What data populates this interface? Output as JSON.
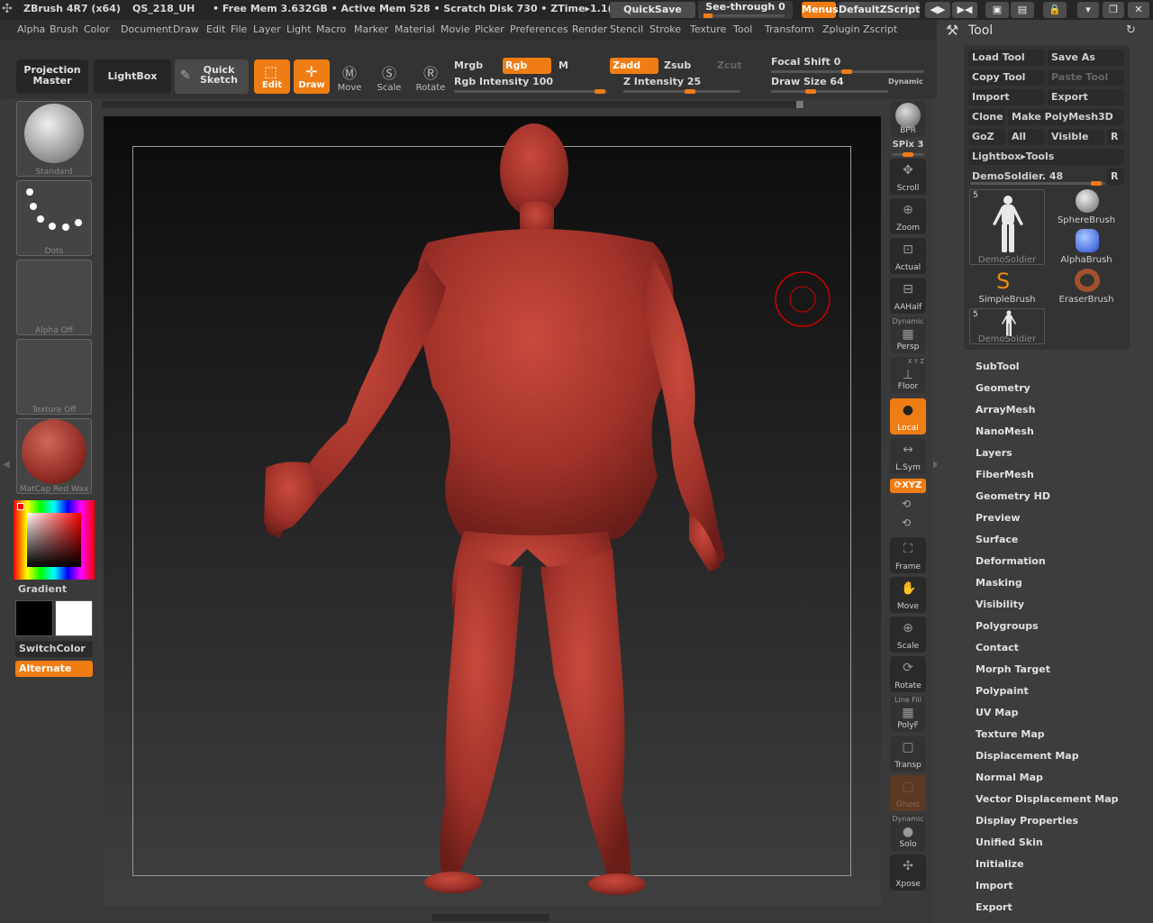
{
  "titlebar": {
    "app_title": "ZBrush 4R7 (x64)",
    "doc_name": "QS_218_UH",
    "free_mem": "• Free Mem 3.632GB • Active Mem 528 • Scratch Disk 730 • ZTime▸1.1(",
    "quicksave": "QuickSave",
    "see_through": "See-through 0",
    "menus": "Menus",
    "default_zscript": "DefaultZScript"
  },
  "menu": [
    "Alpha",
    "Brush",
    "Color",
    "Document",
    "Draw",
    "Edit",
    "File",
    "Layer",
    "Light",
    "Macro",
    "Marker",
    "Material",
    "Movie",
    "Picker",
    "Preferences",
    "Render",
    "Stencil",
    "Stroke",
    "Texture",
    "Tool",
    "Transform",
    "Zplugin",
    "Zscript"
  ],
  "toolbar": {
    "projection_master": "Projection\nMaster",
    "lightbox": "LightBox",
    "quick_sketch": "Quick\nSketch",
    "edit": "Edit",
    "draw": "Draw",
    "move": "Move",
    "scale": "Scale",
    "rotate": "Rotate",
    "mrgb": "Mrgb",
    "rgb": "Rgb",
    "m": "M",
    "zadd": "Zadd",
    "zsub": "Zsub",
    "zcut": "Zcut",
    "rgb_intensity": "Rgb Intensity 100",
    "z_intensity": "Z Intensity 25",
    "focal_shift": "Focal Shift 0",
    "draw_size": "Draw Size 64",
    "dynamic": "Dynamic"
  },
  "left": {
    "brush": "Standard",
    "stroke": "Dots",
    "alpha": "Alpha Off",
    "texture": "Texture Off",
    "material": "MatCap Red Wax",
    "gradient": "Gradient",
    "switch_color": "SwitchColor",
    "alternate": "Alternate"
  },
  "shelf": {
    "bpr": "BPR",
    "spix": "SPix 3",
    "scroll": "Scroll",
    "zoom": "Zoom",
    "actual": "Actual",
    "aahalf": "AAHalf",
    "dynamic": "Dynamic",
    "persp": "Persp",
    "xyz_small": "X Y Z",
    "floor": "Floor",
    "local": "Local",
    "lsym": "L.Sym",
    "xyz": "XYZ",
    "frame": "Frame",
    "move": "Move",
    "scale": "Scale",
    "rotate": "Rotate",
    "line_fill": "Line Fill",
    "polyf": "PolyF",
    "transp": "Transp",
    "ghost": "Ghost",
    "dynamic2": "Dynamic",
    "solo": "Solo",
    "xpose": "Xpose"
  },
  "tool": {
    "title": "Tool",
    "load_tool": "Load Tool",
    "save_as": "Save As",
    "copy_tool": "Copy Tool",
    "paste_tool": "Paste Tool",
    "import": "Import",
    "export": "Export",
    "clone": "Clone",
    "make_polymesh": "Make PolyMesh3D",
    "goz": "GoZ",
    "all": "All",
    "visible": "Visible",
    "r": "R",
    "lightbox_tools": "Lightbox▸Tools",
    "current": "DemoSoldier. 48",
    "items": [
      {
        "label": "DemoSoldier",
        "badge": "5"
      },
      {
        "label": "SphereBrush",
        "badge": ""
      },
      {
        "label": "AlphaBrush",
        "badge": ""
      },
      {
        "label": "SimpleBrush",
        "badge": ""
      },
      {
        "label": "EraserBrush",
        "badge": ""
      },
      {
        "label": "DemoSoldier",
        "badge": "5"
      }
    ],
    "sections": [
      "SubTool",
      "Geometry",
      "ArrayMesh",
      "NanoMesh",
      "Layers",
      "FiberMesh",
      "Geometry HD",
      "Preview",
      "Surface",
      "Deformation",
      "Masking",
      "Visibility",
      "Polygroups",
      "Contact",
      "Morph Target",
      "Polypaint",
      "UV Map",
      "Texture Map",
      "Displacement Map",
      "Normal Map",
      "Vector Displacement Map",
      "Display Properties",
      "Unified Skin",
      "Initialize",
      "Import",
      "Export"
    ]
  },
  "colors": {
    "accent": "#f07d14",
    "model": "#b3372b",
    "bg": "#3a3a3a"
  }
}
